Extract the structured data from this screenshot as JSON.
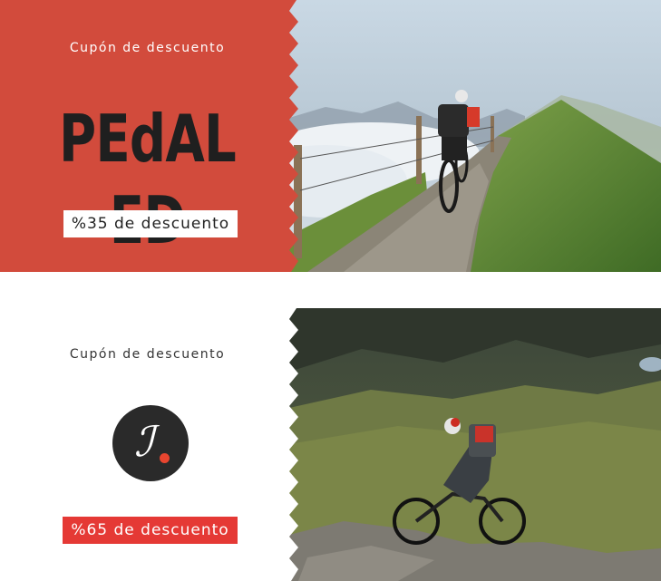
{
  "coupons": [
    {
      "eyebrow": "Cupón de descuento",
      "brand": "PEdAL ED",
      "badge": "%35 de descuento",
      "colors": {
        "panel": "#d24b3c",
        "badge_bg": "#ffffff",
        "badge_text": "#222222"
      },
      "photo": "cyclist riding mountain ridge trail above clouds"
    },
    {
      "eyebrow": "Cupón de descuento",
      "logo_icon": "brand-monogram-icon",
      "badge": "%65 de descuento",
      "colors": {
        "panel": "#ffffff",
        "badge_bg": "#e53935",
        "badge_text": "#ffffff"
      },
      "photo": "cyclist on rocky alpine mountain slope"
    }
  ]
}
